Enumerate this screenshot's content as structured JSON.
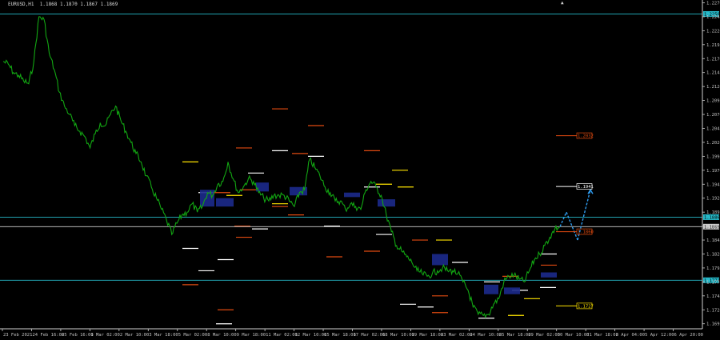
{
  "window": {
    "symbol_info": "EURUSD,H1  1.1868 1.1870 1.1867 1.1869",
    "panel_arrow": "▲"
  },
  "colors": {
    "background": "#000000",
    "price_line": "#12a612",
    "grid_axis": "#cfcfcf",
    "level_cyan": "#26b9c9",
    "level_white": "#ffffff",
    "level_yellow": "#ffe400",
    "level_orange": "#e04a10",
    "zone_navy": "#1c2a8c",
    "forecast": "#2e9cf0"
  },
  "chart_data": {
    "type": "line",
    "title": "",
    "ylim": [
      1.1686,
      1.2275
    ],
    "y_ticks": [
      "1.2270",
      "1.2245",
      "1.2220",
      "1.2195",
      "1.2170",
      "1.2145",
      "1.2120",
      "1.2095",
      "1.2070",
      "1.2045",
      "1.2020",
      "1.1995",
      "1.1970",
      "1.1945",
      "1.1920",
      "1.1895",
      "1.1870",
      "1.1845",
      "1.1820",
      "1.1795",
      "1.1770",
      "1.1745",
      "1.1720",
      "1.1695"
    ],
    "x_ticks": [
      "23 Feb 2021",
      "24 Feb 16:00",
      "25 Feb 16:00",
      "1 Mar 02:00",
      "2 Mar 10:00",
      "3 Mar 18:00",
      "5 Mar 02:00",
      "8 Mar 10:00",
      "9 Mar 18:00",
      "11 Mar 02:00",
      "12 Mar 10:00",
      "15 Mar 18:00",
      "17 Mar 02:00",
      "18 Mar 10:00",
      "19 Mar 18:00",
      "23 Mar 02:00",
      "24 Mar 10:00",
      "25 Mar 18:00",
      "29 Mar 02:00",
      "30 Mar 10:00",
      "31 Mar 18:00",
      "2 Apr 04:00",
      "5 Apr 12:00",
      "6 Apr 20:00"
    ],
    "series": [
      {
        "values": [
          1.2165,
          1.216,
          1.2145,
          1.214,
          1.213,
          1.2125,
          1.2165,
          1.2245,
          1.224,
          1.218,
          1.215,
          1.211,
          1.2085,
          1.207,
          1.205,
          1.204,
          1.203,
          1.201,
          1.2035,
          1.2055,
          1.205,
          1.207,
          1.2085,
          1.206,
          1.204,
          1.202,
          1.2,
          1.1985,
          1.196,
          1.194,
          1.192,
          1.19,
          1.188,
          1.1855,
          1.1875,
          1.189,
          1.1895,
          1.191,
          1.1895,
          1.1905,
          1.193,
          1.1925,
          1.1945,
          1.195,
          1.1985,
          1.1955,
          1.193,
          1.194,
          1.1955,
          1.195,
          1.193,
          1.192,
          1.1915,
          1.1925,
          1.1925,
          1.1925,
          1.1915,
          1.1905,
          1.193,
          1.1935,
          1.199,
          1.1975,
          1.196,
          1.194,
          1.193,
          1.1915,
          1.1915,
          1.19,
          1.191,
          1.1905,
          1.19,
          1.1935,
          1.195,
          1.194,
          1.1925,
          1.189,
          1.186,
          1.1835,
          1.1825,
          1.1815,
          1.1805,
          1.179,
          1.1785,
          1.178,
          1.1785,
          1.179,
          1.1795,
          1.179,
          1.179,
          1.1785,
          1.177,
          1.1755,
          1.1725,
          1.1712,
          1.171,
          1.1712,
          1.173,
          1.174,
          1.177,
          1.178,
          1.1782,
          1.1775,
          1.177,
          1.179,
          1.181,
          1.182,
          1.1835,
          1.185,
          1.1865,
          1.1869
        ]
      }
    ],
    "horizontal_lines": [
      {
        "price": 1.225,
        "color": "#26b9c9",
        "label": "1.2250"
      },
      {
        "price": 1.1886,
        "color": "#26b9c9",
        "label": "1.1886"
      },
      {
        "price": 1.1773,
        "color": "#26b9c9",
        "label": "1.1773"
      },
      {
        "price": 1.1869,
        "color": "#cfcfcf",
        "label": "1.1869"
      }
    ],
    "price_tags": [
      {
        "price": 1.2032,
        "color": "#e04a10",
        "label": "1.2032"
      },
      {
        "price": 1.1941,
        "color": "#ffffff",
        "label": "1.1941"
      },
      {
        "price": 1.186,
        "color": "#e04a10",
        "label": "1.1860"
      },
      {
        "price": 1.1727,
        "color": "#ffe400",
        "label": "1.1727"
      }
    ],
    "forecast": [
      [
        1.1869,
        1.1895
      ],
      [
        1.1895,
        1.1845
      ],
      [
        1.1845,
        1.1935
      ]
    ]
  }
}
